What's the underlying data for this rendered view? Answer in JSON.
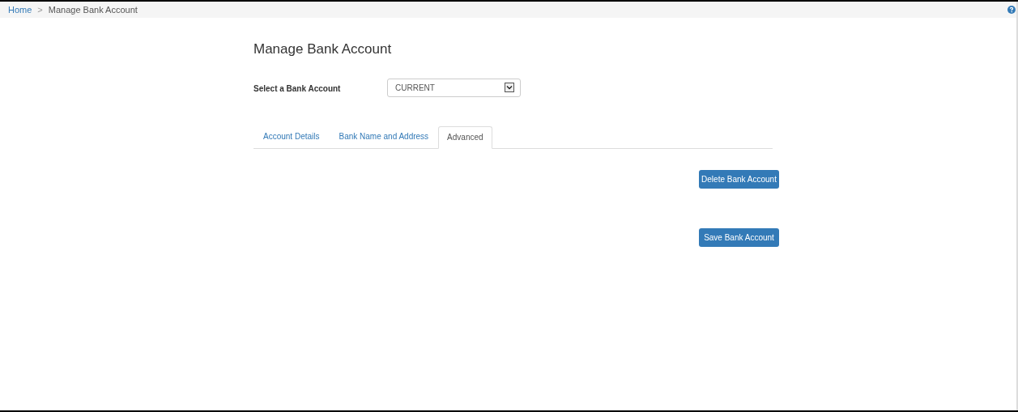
{
  "breadcrumb": [
    {
      "label": "Home",
      "kind": "link"
    },
    {
      "label": ">",
      "kind": "separator"
    },
    {
      "label": "Manage Bank Account",
      "kind": "current"
    }
  ],
  "page_title": "Manage Bank Account",
  "account_select": {
    "label": "Select a Bank Account",
    "value": "CURRENT"
  },
  "tabs": [
    {
      "label": "Account Details",
      "selected": false
    },
    {
      "label": "Bank Name and Address",
      "selected": false
    },
    {
      "label": "Advanced",
      "selected": true
    }
  ],
  "buttons": [
    "Delete Bank Account",
    "Save Bank Account"
  ]
}
